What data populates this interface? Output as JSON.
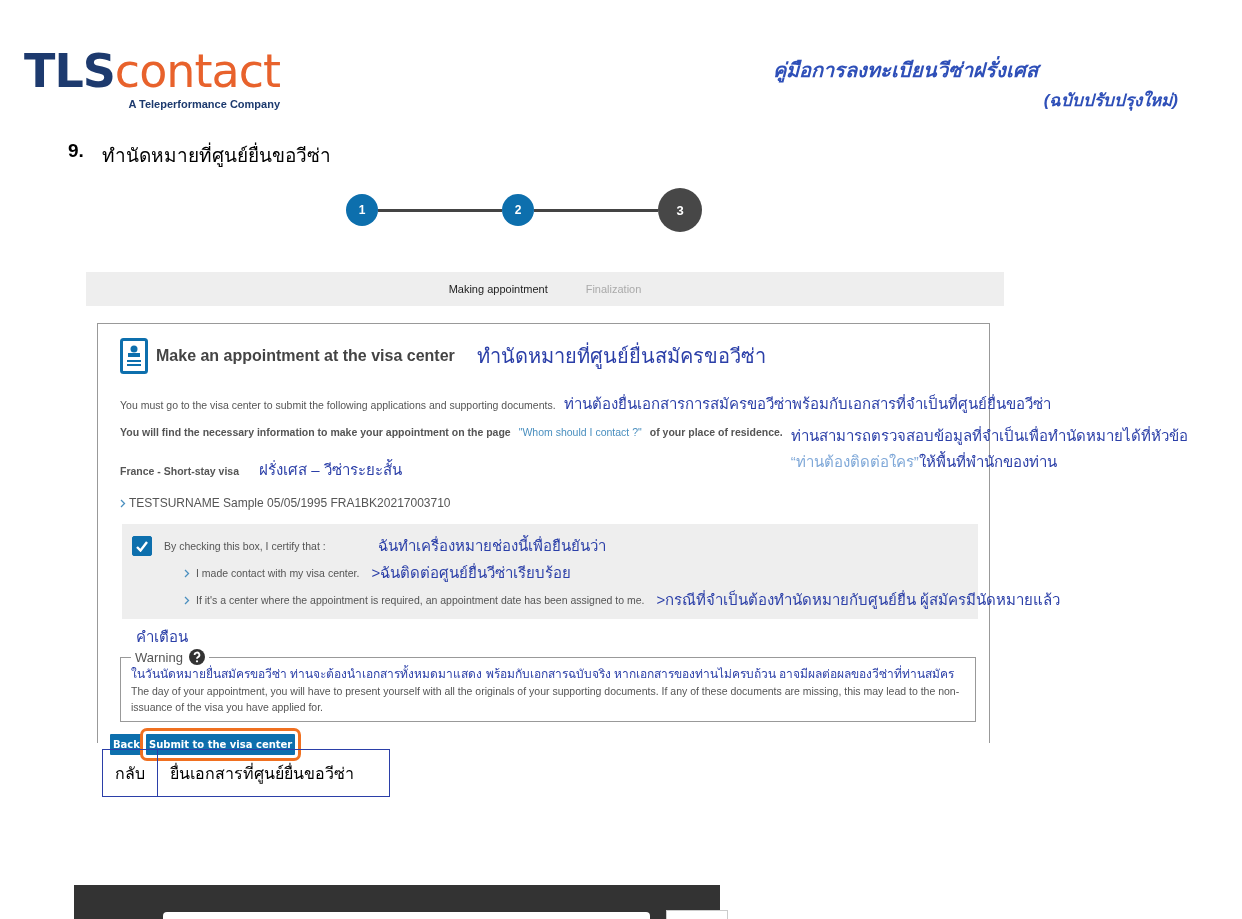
{
  "header": {
    "logo": {
      "part_a": "TLS",
      "part_b": "contact",
      "tagline": "A Teleperformance Company"
    },
    "title": "คู่มือการลงทะเบียนวีซ่าฝรั่งเศส",
    "subtitle": "(ฉบับปรับปรุงใหม่)"
  },
  "section": {
    "number": "9.",
    "title": "ทำนัดหมายที่ศูนย์ยื่นขอวีซ่า"
  },
  "stepper": [
    {
      "label": "1",
      "selected": false
    },
    {
      "label": "2",
      "selected": false
    },
    {
      "label": "3",
      "selected": true
    }
  ],
  "tabs": [
    {
      "label": "Making appointment",
      "selected": true
    },
    {
      "label": "Finalization",
      "selected": false
    }
  ],
  "card": {
    "title": "Make an appointment at the visa center",
    "title_note": "ทำนัดหมายที่ศูนย์ยื่นสมัครขอวีซ่า",
    "intro": {
      "text": "You must go to the visa center to submit the following applications and supporting documents.",
      "note": "ท่านต้องยื่นเอกสารการสมัครขอวีซ่าพร้อมกับเอกสารที่จำเป็นที่ศูนย์ยื่นขอวีซ่า"
    },
    "info": {
      "before": "You will find the necessary information to make your appointment on the page",
      "link": "\"Whom should I contact ?\"",
      "after": "of your place of residence.",
      "note": "ท่านสามารถตรวจสอบข้อมูลที่จำเป็นเพื่อทำนัดหมายได้ที่หัวข้อ",
      "note_link": "“ท่านต้องติดต่อใคร”",
      "note_after": "ให้พื้นที่พำนักของท่าน"
    },
    "visa": {
      "text": "France - Short-stay visa",
      "note": "ฝรั่งเศส – วีซ่าระยะสั้น"
    },
    "applicant": "TESTSURNAME Sample 05/05/1995 FRA1BK20217003710",
    "certify": {
      "checked": true,
      "text": "By checking this box, I certify that :",
      "note": "ฉันทำเครื่องหมายช่องนี้เพื่อยืนยันว่า",
      "items": [
        {
          "text": "I made contact with my visa center.",
          "note": ">ฉันติดต่อศูนย์ยื่นวีซ่าเรียบร้อย"
        },
        {
          "text": "If it's a center where the appointment is required, an appointment date has been assigned to me.",
          "note": ">กรณีที่จำเป็นต้องทำนัดหมายกับศูนย์ยื่น ผู้สมัครมีนัดหมายแล้ว"
        }
      ]
    },
    "warning": {
      "label_note": "คำเตือน",
      "legend": "Warning",
      "note": "ในวันนัดหมายยื่นสมัครขอวีซ่า ท่านจะต้องนำเอกสารทั้งหมดมาแสดง พร้อมกับเอกสารฉบับจริง หากเอกสารของท่านไม่ครบถ้วน อาจมีผลต่อผลของวีซ่าที่ท่านสมัคร",
      "text": "The day of your appointment, you will have to present yourself with all the originals of your supporting documents. If any of these documents are missing, this may lead to the non-issuance of the visa you have applied for."
    },
    "buttons": [
      {
        "label": "Back",
        "highlighted": false
      },
      {
        "label": "Submit to the visa center",
        "highlighted": true
      }
    ]
  },
  "legend_table": [
    "กลับ",
    "ยื่นเอกสารที่ศูนย์ยื่นขอวีซ่า"
  ]
}
